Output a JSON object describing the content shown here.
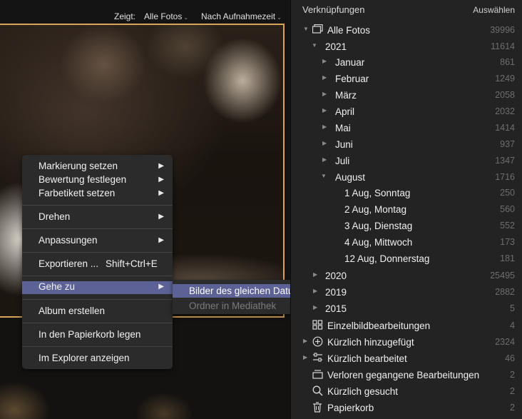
{
  "topbar": {
    "show_label": "Zeigt:",
    "show_value": "Alle Fotos",
    "sort_value": "Nach Aufnahmezeit"
  },
  "context_menu": {
    "items": [
      {
        "label": "Markierung setzen",
        "has_submenu": true
      },
      {
        "label": "Bewertung festlegen",
        "has_submenu": true
      },
      {
        "label": "Farbetikett setzen",
        "has_submenu": true
      },
      {
        "label": "Drehen",
        "has_submenu": true
      },
      {
        "label": "Anpassungen",
        "has_submenu": true
      },
      {
        "label": "Exportieren ...",
        "shortcut": "Shift+Ctrl+E"
      },
      {
        "label": "Gehe zu",
        "has_submenu": true,
        "highlighted": true
      },
      {
        "label": "Album erstellen"
      },
      {
        "label": "In den Papierkorb legen"
      },
      {
        "label": "Im Explorer anzeigen"
      }
    ],
    "submenu": {
      "items": [
        {
          "label": "Bilder des gleichen Datums",
          "highlighted": true
        },
        {
          "label": "Ordner in Mediathek",
          "disabled": true
        }
      ]
    }
  },
  "panel": {
    "title": "Verknüpfungen",
    "select_label": "Auswählen",
    "tree": [
      {
        "label": "Alle Fotos",
        "count": "39996",
        "icon": "photos-icon",
        "expanded": true
      },
      {
        "label": "2021",
        "count": "11614",
        "expanded": true
      },
      {
        "label": "Januar",
        "count": "861"
      },
      {
        "label": "Februar",
        "count": "1249"
      },
      {
        "label": "März",
        "count": "2058"
      },
      {
        "label": "April",
        "count": "2032"
      },
      {
        "label": "Mai",
        "count": "1414"
      },
      {
        "label": "Juni",
        "count": "937"
      },
      {
        "label": "Juli",
        "count": "1347"
      },
      {
        "label": "August",
        "count": "1716",
        "expanded": true
      },
      {
        "label": "1 Aug, Sonntag",
        "count": "250"
      },
      {
        "label": "2 Aug, Montag",
        "count": "560"
      },
      {
        "label": "3 Aug, Dienstag",
        "count": "552"
      },
      {
        "label": "4 Aug, Mittwoch",
        "count": "173"
      },
      {
        "label": "12 Aug, Donnerstag",
        "count": "181"
      },
      {
        "label": "2020",
        "count": "25495"
      },
      {
        "label": "2019",
        "count": "2882"
      },
      {
        "label": "2015",
        "count": "5"
      }
    ],
    "shortcuts": [
      {
        "label": "Einzelbildbearbeitungen",
        "count": "4",
        "icon": "grid-icon"
      },
      {
        "label": "Kürzlich hinzugefügt",
        "count": "2324",
        "icon": "plus-circle-icon"
      },
      {
        "label": "Kürzlich bearbeitet",
        "count": "46",
        "icon": "sliders-icon"
      },
      {
        "label": "Verloren gegangene Bearbeitungen",
        "count": "2",
        "icon": "stack-icon"
      },
      {
        "label": "Kürzlich gesucht",
        "count": "2",
        "icon": "search-icon"
      },
      {
        "label": "Papierkorb",
        "count": "2",
        "icon": "trash-icon"
      }
    ]
  },
  "colors": {
    "accent": "#5c6296",
    "photo_border": "#d8a55a",
    "panel_bg": "#232323"
  }
}
